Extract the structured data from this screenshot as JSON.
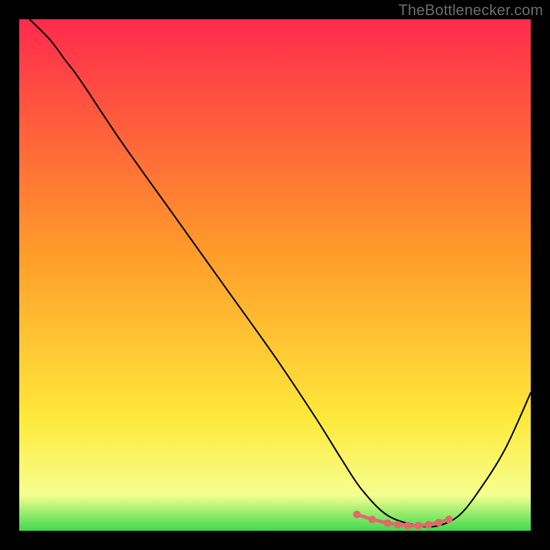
{
  "attribution": "TheBottlenecker.com",
  "chart_data": {
    "type": "line",
    "title": "",
    "xlabel": "",
    "ylabel": "",
    "xlim": [
      0,
      100
    ],
    "ylim": [
      0,
      100
    ],
    "grid": false,
    "legend": false,
    "background_gradient": {
      "top": "#ff2a4d",
      "mid1": "#ff9a2a",
      "mid2": "#ffe93a",
      "bottom_band": "#f6ff8f",
      "bottom_edge": "#3fd94f"
    },
    "series": [
      {
        "name": "curve",
        "color": "#000000",
        "x": [
          2,
          6,
          9,
          12,
          20,
          30,
          40,
          50,
          58,
          63,
          67,
          72,
          78,
          82,
          86,
          90,
          95,
          100
        ],
        "y": [
          100,
          96,
          92,
          88,
          76,
          62,
          48,
          34,
          22,
          14,
          8,
          3,
          1,
          1,
          3,
          8,
          16,
          27
        ]
      },
      {
        "name": "highlight-dots",
        "color": "#e06a6a",
        "x": [
          66,
          69,
          72,
          74,
          76,
          78,
          80,
          82,
          84
        ],
        "y": [
          3.2,
          2.2,
          1.5,
          1.2,
          1.0,
          1.0,
          1.2,
          1.6,
          2.2
        ]
      }
    ]
  }
}
